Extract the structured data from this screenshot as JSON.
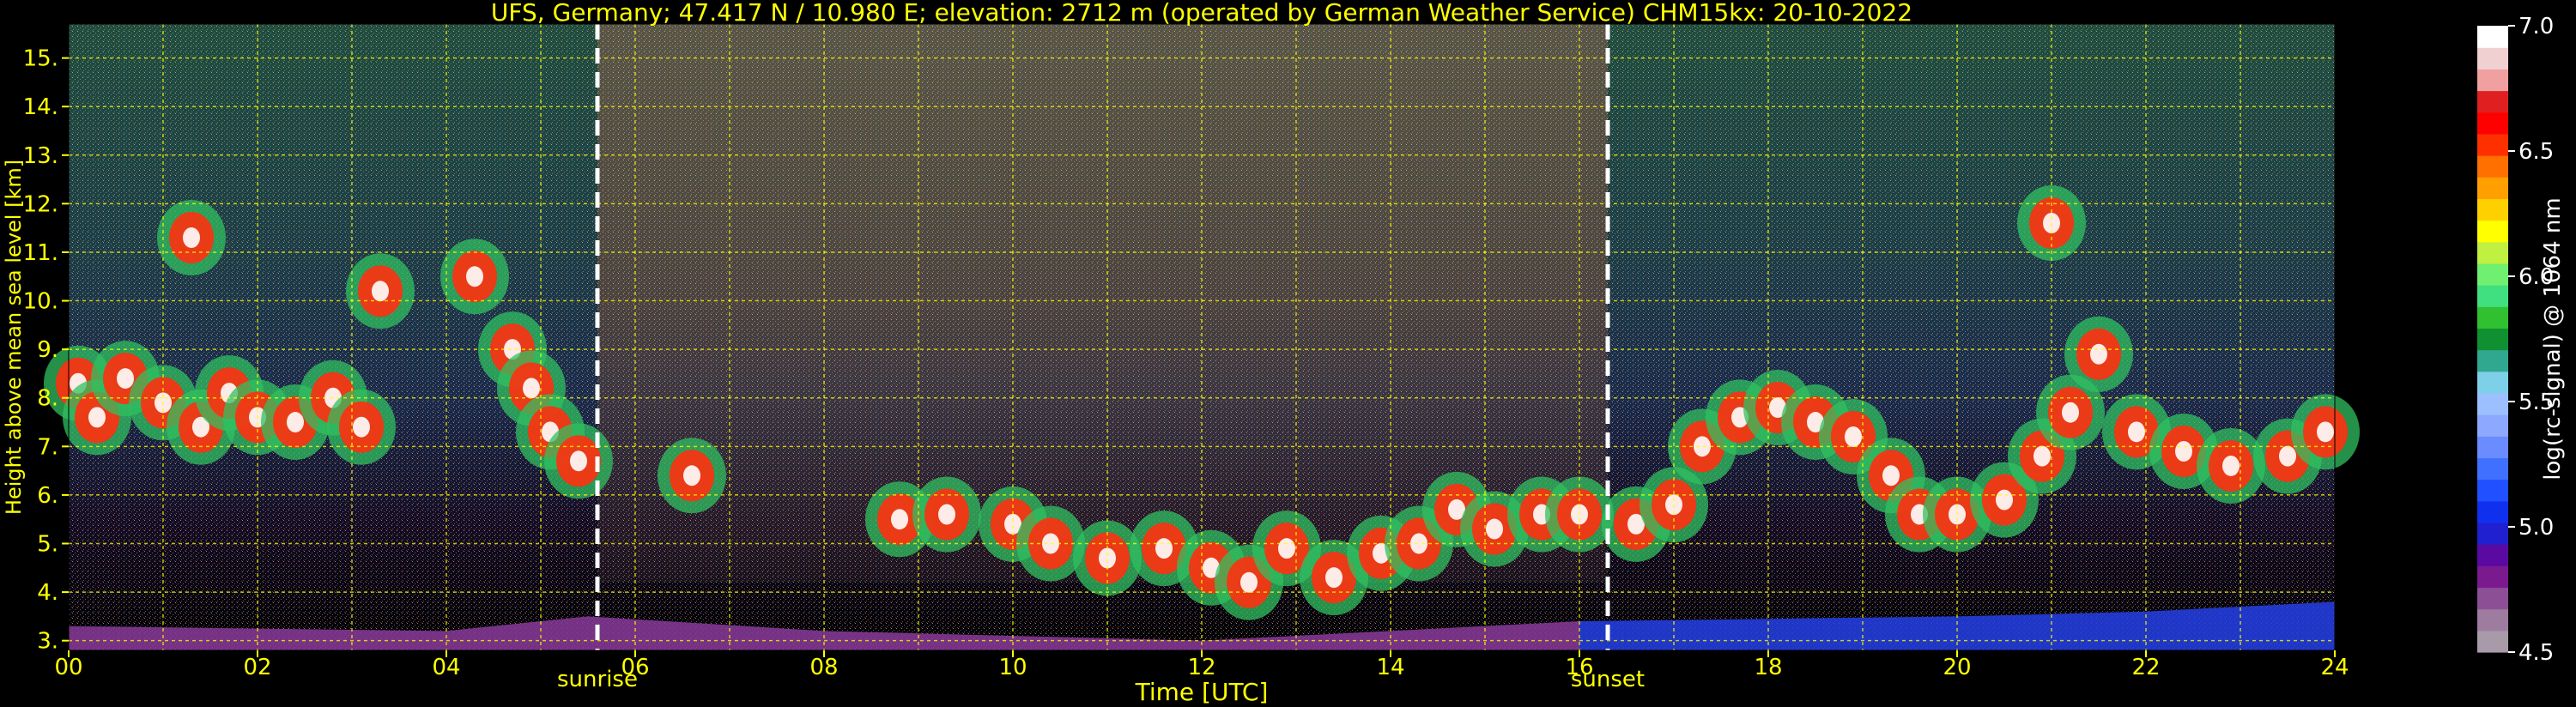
{
  "chart_data": {
    "type": "heatmap",
    "title": "UFS, Germany; 47.417 N / 10.980 E; elevation: 2712 m  (operated by German Weather Service)    CHM15kx: 20-10-2022",
    "xlabel": "Time [UTC]",
    "ylabel": "Height above mean sea level [km]",
    "x_ticks": [
      "00",
      "02",
      "04",
      "06",
      "08",
      "10",
      "12",
      "14",
      "16",
      "18",
      "20",
      "22",
      "24"
    ],
    "xlim": [
      0,
      24
    ],
    "y_ticks": [
      "3.",
      "4.",
      "5.",
      "6.",
      "7.",
      "8.",
      "9.",
      "10.",
      "11.",
      "12.",
      "13.",
      "14.",
      "15."
    ],
    "ylim": [
      2.8,
      15.7
    ],
    "grid": true,
    "annotations": [
      {
        "label": "sunrise",
        "x": 5.6
      },
      {
        "label": "sunset",
        "x": 16.3
      }
    ],
    "colorbar": {
      "label": "log(rc-signal) @ 1064 nm",
      "range": [
        4.5,
        7.0
      ],
      "ticks": [
        "4.5",
        "5.0",
        "5.5",
        "6.0",
        "6.5",
        "7.0"
      ],
      "colors": [
        "#a89aa8",
        "#9e7ca0",
        "#8c4f96",
        "#7a1a8e",
        "#5a0aa0",
        "#2020d0",
        "#1030f0",
        "#2050ff",
        "#4070ff",
        "#6a8cff",
        "#8ca8ff",
        "#9cc0ff",
        "#7dd0e8",
        "#30a890",
        "#109030",
        "#30c030",
        "#40e080",
        "#70f070",
        "#c0f040",
        "#ffff00",
        "#ffd000",
        "#ffa000",
        "#ff7000",
        "#ff3000",
        "#ff0000",
        "#e02020",
        "#f0a0a0",
        "#f0d0d0",
        "#ffffff"
      ]
    },
    "layers": [
      {
        "name": "cloud-bands",
        "points": [
          [
            0.1,
            8.3
          ],
          [
            0.3,
            7.6
          ],
          [
            0.6,
            8.4
          ],
          [
            1.0,
            7.9
          ],
          [
            1.4,
            7.4
          ],
          [
            1.7,
            8.1
          ],
          [
            2.0,
            7.6
          ],
          [
            2.4,
            7.5
          ],
          [
            2.8,
            8.0
          ],
          [
            3.1,
            7.4
          ],
          [
            3.3,
            10.2
          ],
          [
            1.3,
            11.3
          ],
          [
            4.3,
            10.5
          ],
          [
            4.7,
            9.0
          ],
          [
            4.9,
            8.2
          ],
          [
            5.1,
            7.3
          ],
          [
            5.4,
            6.7
          ],
          [
            6.6,
            6.4
          ],
          [
            8.8,
            5.5
          ],
          [
            9.3,
            5.6
          ],
          [
            10.0,
            5.4
          ],
          [
            10.4,
            5.0
          ],
          [
            11.0,
            4.7
          ],
          [
            11.6,
            4.9
          ],
          [
            12.1,
            4.5
          ],
          [
            12.5,
            4.2
          ],
          [
            12.9,
            4.9
          ],
          [
            13.4,
            4.3
          ],
          [
            13.9,
            4.8
          ],
          [
            14.3,
            5.0
          ],
          [
            14.7,
            5.7
          ],
          [
            15.1,
            5.3
          ],
          [
            15.6,
            5.6
          ],
          [
            16.0,
            5.6
          ],
          [
            16.6,
            5.4
          ],
          [
            17.0,
            5.8
          ],
          [
            17.3,
            7.0
          ],
          [
            17.7,
            7.6
          ],
          [
            18.1,
            7.8
          ],
          [
            18.5,
            7.5
          ],
          [
            18.9,
            7.2
          ],
          [
            19.3,
            6.4
          ],
          [
            19.6,
            5.6
          ],
          [
            20.0,
            5.6
          ],
          [
            20.5,
            5.9
          ],
          [
            20.9,
            6.8
          ],
          [
            21.2,
            7.7
          ],
          [
            21.5,
            8.9
          ],
          [
            21.9,
            7.3
          ],
          [
            22.4,
            6.9
          ],
          [
            22.9,
            6.6
          ],
          [
            23.5,
            6.8
          ],
          [
            23.9,
            7.3
          ],
          [
            21.0,
            11.6
          ]
        ]
      },
      {
        "name": "boundary-layer",
        "points": [
          [
            0,
            3.3
          ],
          [
            4,
            3.2
          ],
          [
            5.5,
            3.5
          ],
          [
            8,
            3.2
          ],
          [
            12,
            3.0
          ],
          [
            16,
            3.4
          ],
          [
            20,
            3.5
          ],
          [
            22,
            3.6
          ],
          [
            24,
            3.8
          ]
        ]
      }
    ]
  }
}
